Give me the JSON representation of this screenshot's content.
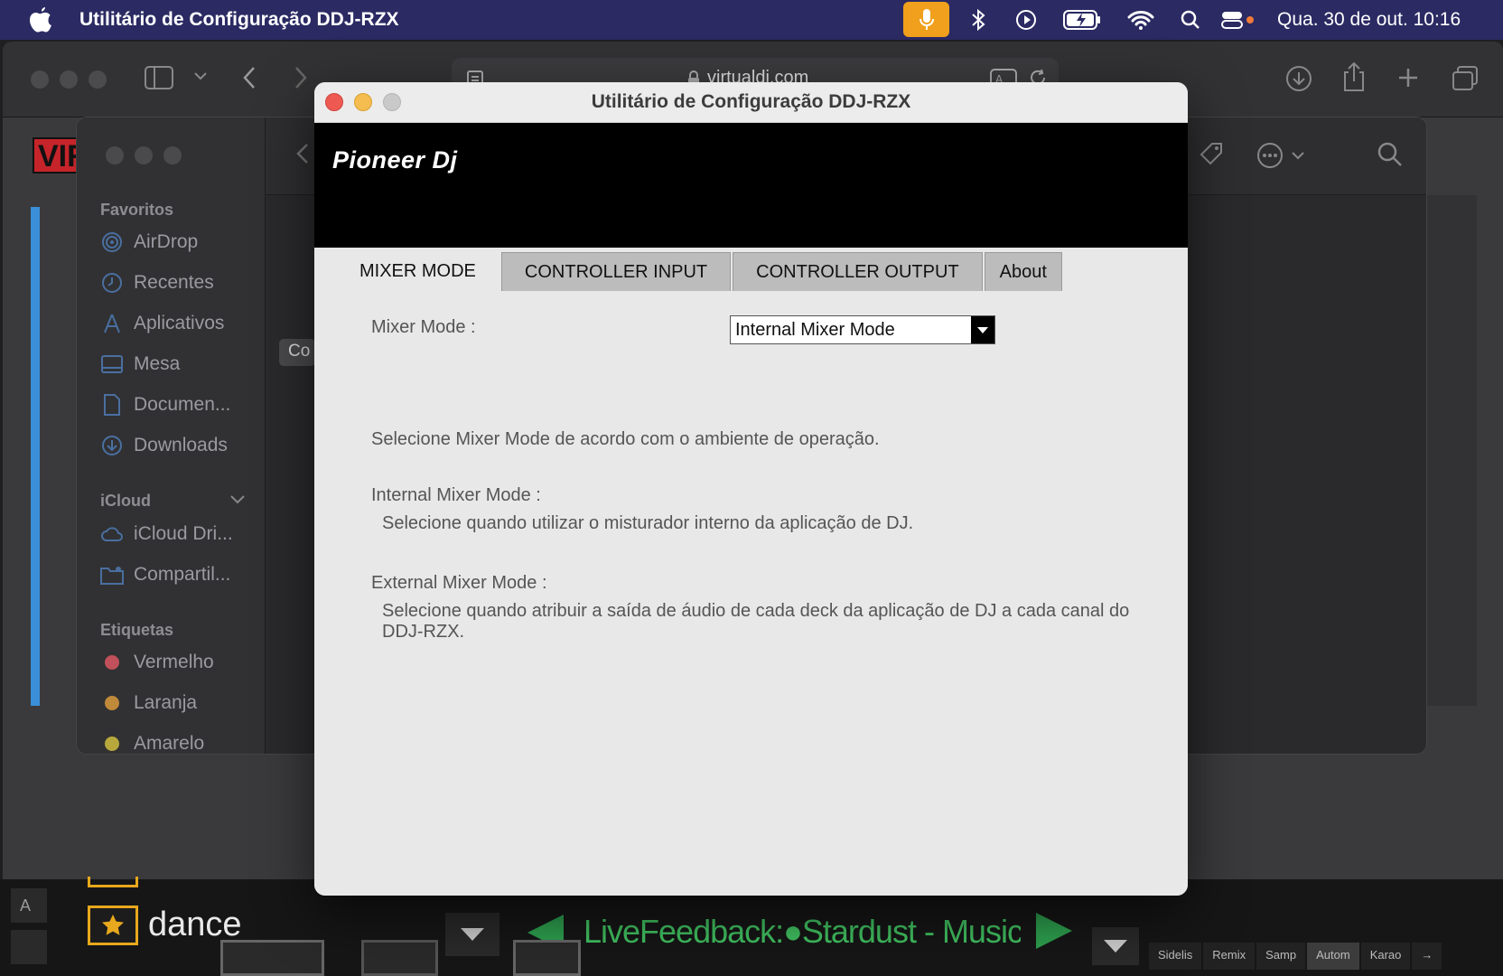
{
  "menubar": {
    "app_title": "Utilitário de Configuração DDJ-RZX",
    "clock": "Qua. 30 de out.  10:16"
  },
  "safari": {
    "url": "virtualdj.com"
  },
  "finder": {
    "tooltip": "Co",
    "favorites_header": "Favoritos",
    "favorites": [
      {
        "label": "AirDrop",
        "icon": "airdrop-icon"
      },
      {
        "label": "Recentes",
        "icon": "clock-icon"
      },
      {
        "label": "Aplicativos",
        "icon": "applications-icon"
      },
      {
        "label": "Mesa",
        "icon": "desktop-icon"
      },
      {
        "label": "Documen...",
        "icon": "document-icon"
      },
      {
        "label": "Downloads",
        "icon": "download-icon"
      }
    ],
    "icloud_header": "iCloud",
    "icloud": [
      {
        "label": "iCloud Dri...",
        "icon": "cloud-icon"
      },
      {
        "label": "Compartil...",
        "icon": "shared-folder-icon"
      }
    ],
    "tags_header": "Etiquetas",
    "tags": [
      {
        "label": "Vermelho",
        "color": "#c0505a"
      },
      {
        "label": "Laranja",
        "color": "#c08a3a"
      },
      {
        "label": "Amarelo",
        "color": "#b8a83c"
      }
    ]
  },
  "util": {
    "title": "Utilitário de Configuração DDJ-RZX",
    "brand": "Pioneer Dj",
    "tabs": [
      "MIXER MODE",
      "CONTROLLER INPUT",
      "CONTROLLER OUTPUT",
      "About"
    ],
    "active_tab": "MIXER MODE",
    "mixer_mode_label": "Mixer Mode :",
    "mixer_mode_value": "Internal Mixer Mode",
    "intro": "Selecione Mixer Mode de acordo com o ambiente de operação.",
    "internal_title": "Internal Mixer Mode :",
    "internal_desc": "Selecione quando utilizar o misturador interno da aplicação de DJ.",
    "external_title": "External Mixer Mode :",
    "external_desc": "Selecione quando atribuir a saída de áudio de cada deck da aplicação de DJ a cada canal do DDJ-RZX."
  },
  "dj": {
    "folder": "dance",
    "now_playing": "LiveFeedback:●Stardust - Music Sounds Better",
    "tabs": [
      "Sidelis",
      "Remix",
      "Samp",
      "Autom",
      "Karao",
      "→"
    ]
  },
  "colors": {
    "menubar_bg": "#2b2a63",
    "mic_accent": "#f0a01c",
    "close": "#ee5a52",
    "minimize": "#f5bd4f",
    "zoom_inactive": "#c9c9c9",
    "now_playing": "#40c060"
  }
}
